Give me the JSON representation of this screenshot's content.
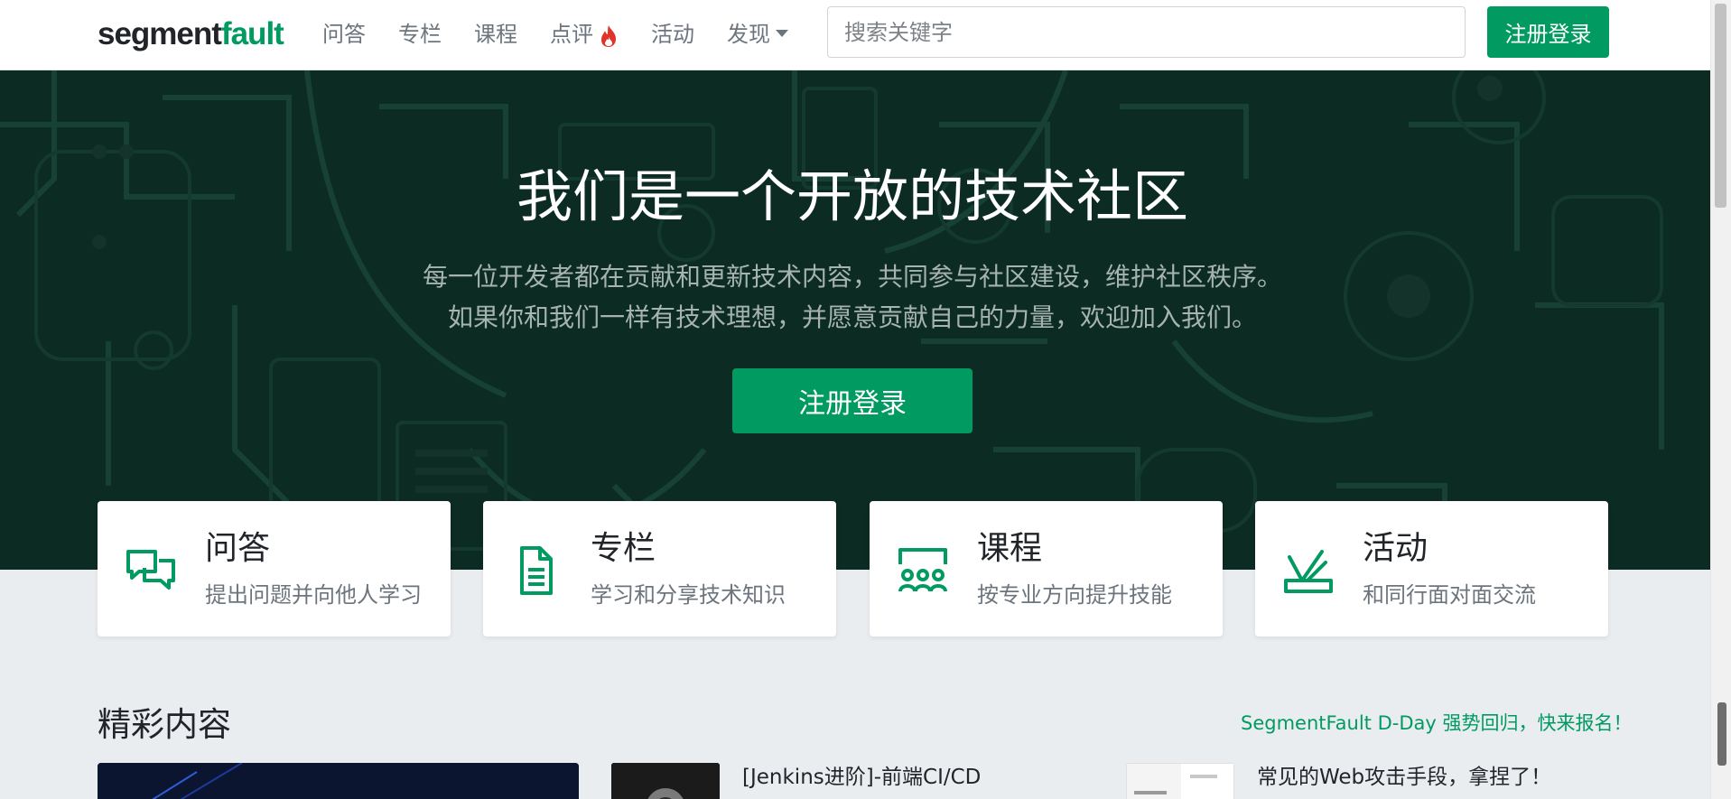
{
  "header": {
    "logo_part1": "segment",
    "logo_part2": "fault",
    "nav": [
      "问答",
      "专栏",
      "课程",
      "点评",
      "活动",
      "发现"
    ],
    "search_placeholder": "搜索关键字",
    "login_button": "注册登录"
  },
  "hero": {
    "title": "我们是一个开放的技术社区",
    "subtitle_line1": "每一位开发者都在贡献和更新技术内容，共同参与社区建设，维护社区秩序。",
    "subtitle_line2": "如果你和我们一样有技术理想，并愿意贡献自己的力量，欢迎加入我们。",
    "button": "注册登录"
  },
  "features": [
    {
      "title": "问答",
      "desc": "提出问题并向他人学习",
      "icon": "chat-bubbles-icon"
    },
    {
      "title": "专栏",
      "desc": "学习和分享技术知识",
      "icon": "document-icon"
    },
    {
      "title": "课程",
      "desc": "按专业方向提升技能",
      "icon": "classroom-icon"
    },
    {
      "title": "活动",
      "desc": "和同行面对面交流",
      "icon": "activity-icon"
    }
  ],
  "content": {
    "section_title": "精彩内容",
    "promo": "SegmentFault D-Day 强势回归，快来报名！",
    "articles": [
      {
        "title": "[Jenkins进阶]-前端CI/CD"
      },
      {
        "title": "常见的Web攻击手段，拿捏了！"
      }
    ]
  },
  "colors": {
    "brand": "#019a61",
    "hero_bg": "#0c2d24",
    "page_bg": "#eaedf0"
  }
}
